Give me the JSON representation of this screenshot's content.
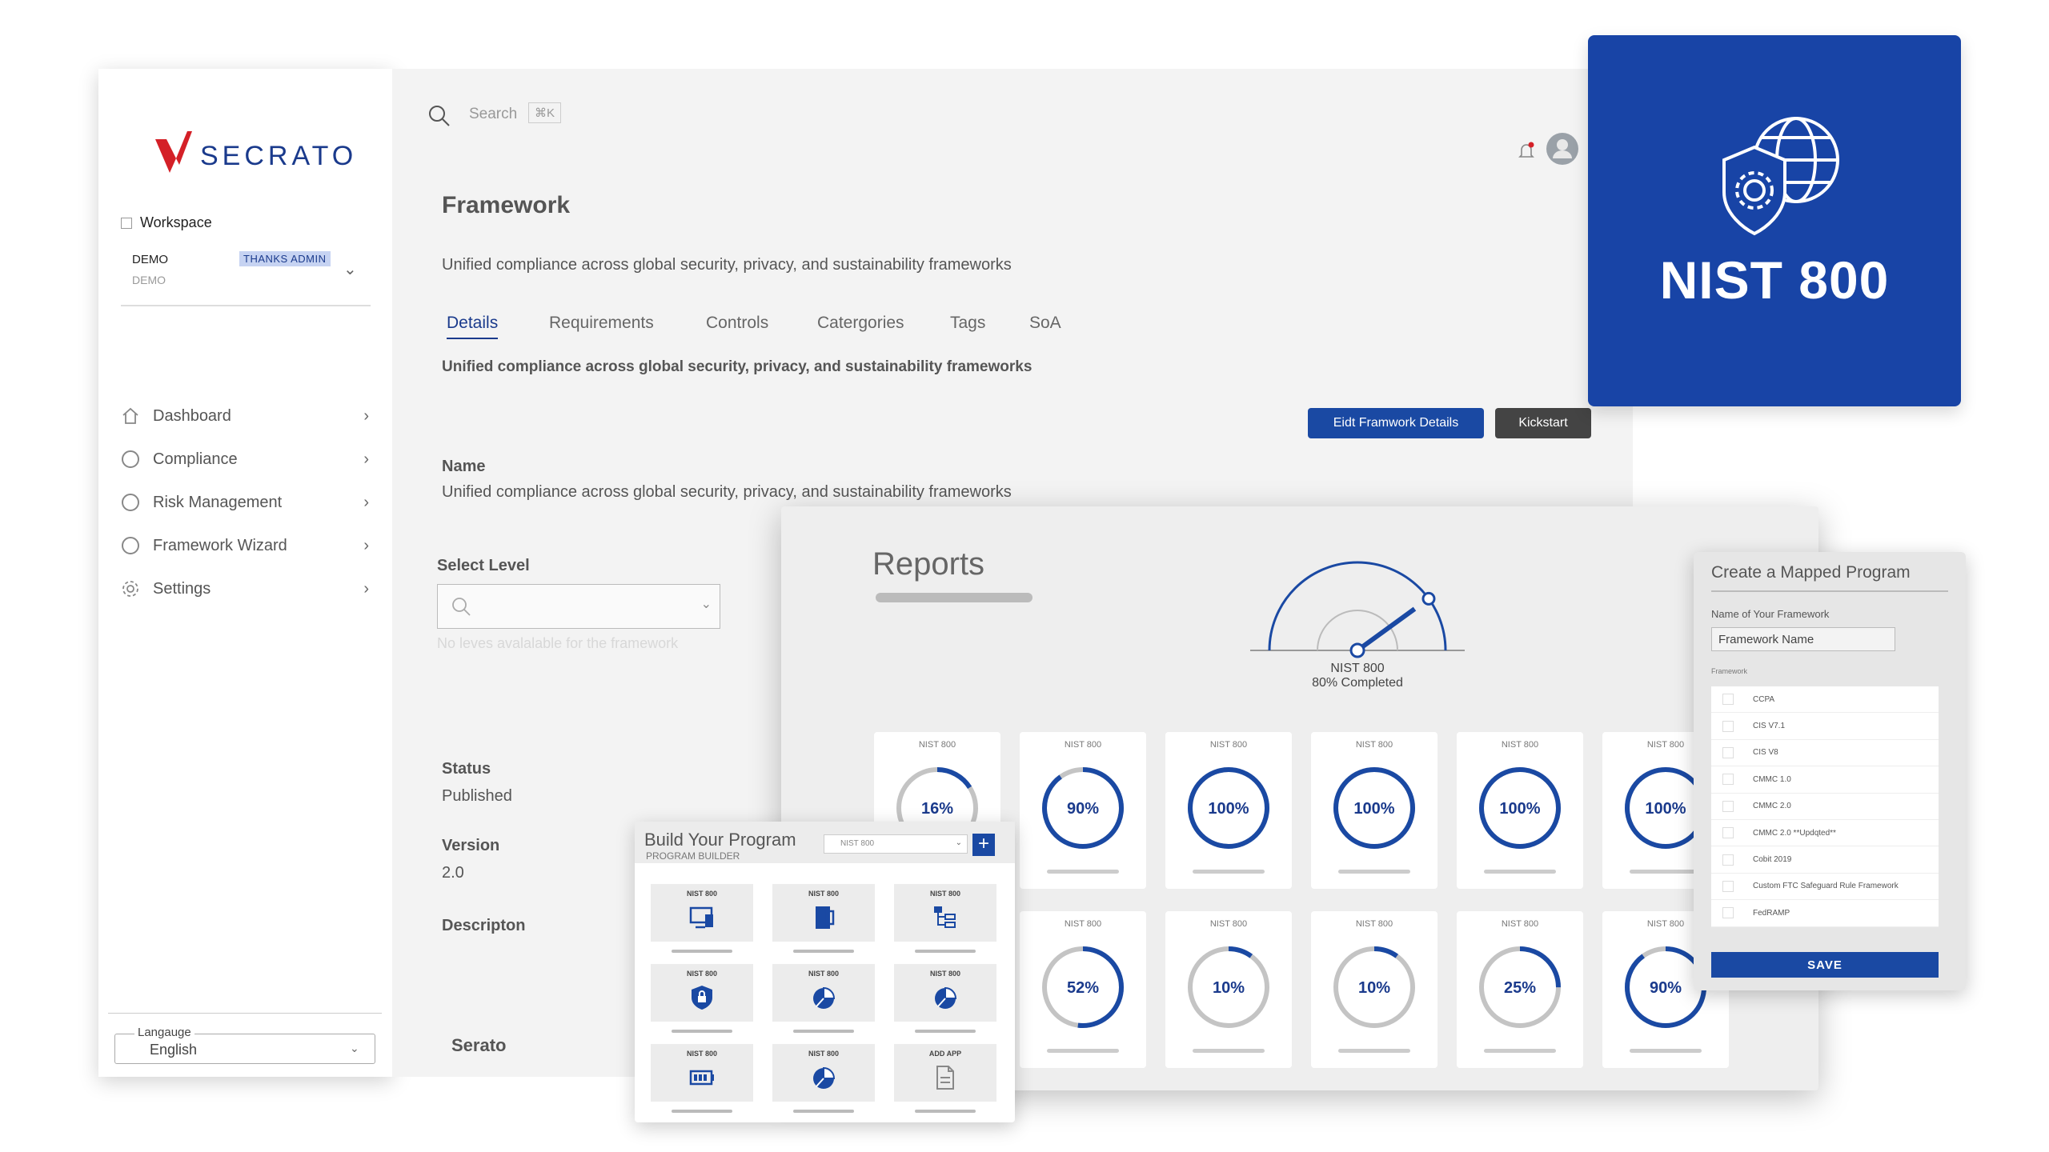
{
  "brand": {
    "name": "SECRATO"
  },
  "sidebar": {
    "workspace_label": "Workspace",
    "workspace_name": "DEMO",
    "workspace_sub": "DEMO",
    "workspace_badge": "THANKS ADMIN",
    "items": [
      {
        "label": "Dashboard",
        "icon": "home-icon"
      },
      {
        "label": "Compliance",
        "icon": "circle-icon"
      },
      {
        "label": "Risk Management",
        "icon": "circle-icon"
      },
      {
        "label": "Framework Wizard",
        "icon": "circle-icon"
      },
      {
        "label": "Settings",
        "icon": "gear-icon"
      }
    ],
    "language_label": "Langauge",
    "language_value": "English"
  },
  "main": {
    "search_placeholder": "Search",
    "search_shortcut": "⌘K",
    "title": "Framework",
    "subtitle": "Unified compliance across global security, privacy, and sustainability frameworks",
    "tabs": [
      "Details",
      "Requirements",
      "Controls",
      "Catergories",
      "Tags",
      "SoA"
    ],
    "bold_subtitle": "Unified compliance across global security, privacy, and sustainability frameworks",
    "edit_button": "Eidt Framwork Details",
    "kickstart_button": "Kickstart",
    "name_label": "Name",
    "name_value": "Unified compliance across global security, privacy, and sustainability frameworks",
    "select_level_label": "Select Level",
    "select_level_hint": "No leves avalalable for the framework",
    "status_label": "Status",
    "status_value": "Published",
    "version_label": "Version",
    "version_value": "2.0",
    "description_label": "Descripton",
    "footer_name": "Serato"
  },
  "nist_card": {
    "title": "NIST 800"
  },
  "reports": {
    "title": "Reports",
    "gauge_title": "NIST 800",
    "gauge_sub": "80% Completed",
    "gauge_value": 80,
    "cards": [
      {
        "label": "NIST 800",
        "value": "16%",
        "pct": 16
      },
      {
        "label": "NIST 800",
        "value": "90%",
        "pct": 90
      },
      {
        "label": "NIST 800",
        "value": "100%",
        "pct": 100
      },
      {
        "label": "NIST 800",
        "value": "100%",
        "pct": 100
      },
      {
        "label": "NIST 800",
        "value": "100%",
        "pct": 100
      },
      {
        "label": "NIST 800",
        "value": "100%",
        "pct": 100
      },
      {
        "label": "NIST 800",
        "value": "52%",
        "pct": 52
      },
      {
        "label": "NIST 800",
        "value": "10%",
        "pct": 10
      },
      {
        "label": "NIST 800",
        "value": "10%",
        "pct": 10
      },
      {
        "label": "NIST 800",
        "value": "25%",
        "pct": 25
      },
      {
        "label": "NIST 800",
        "value": "90%",
        "pct": 90
      }
    ]
  },
  "builder": {
    "title": "Build Your Program",
    "subtitle": "PROGRAM BUILDER",
    "select_value": "NIST 800",
    "add_label": "+",
    "tiles": [
      {
        "label": "NIST 800",
        "icon": "devices-icon"
      },
      {
        "label": "NIST 800",
        "icon": "door-icon"
      },
      {
        "label": "NIST 800",
        "icon": "hierarchy-icon"
      },
      {
        "label": "NIST 800",
        "icon": "shield-lock-icon"
      },
      {
        "label": "NIST 800",
        "icon": "pie-chart-icon"
      },
      {
        "label": "NIST 800",
        "icon": "pie-chart-icon"
      },
      {
        "label": "NIST 800",
        "icon": "battery-icon"
      },
      {
        "label": "NIST 800",
        "icon": "pie-chart-icon"
      },
      {
        "label": "ADD APP",
        "icon": "document-icon"
      }
    ]
  },
  "mapped": {
    "title": "Create a Mapped Program",
    "name_label": "Name of Your Framework",
    "name_value": "Framework Name",
    "framework_label": "Framework",
    "frameworks": [
      "CCPA",
      "CIS V7.1",
      "CIS V8",
      "CMMC 1.0",
      "CMMC 2.0",
      "CMMC 2.0 **Updqted**",
      "Cobit 2019",
      "Custom FTC Safeguard Rule Framework",
      "FedRAMP"
    ],
    "save_label": "SAVE"
  },
  "colors": {
    "brand_blue": "#1a49a3",
    "brand_red": "#d42027",
    "card_blue": "#1844a6"
  }
}
